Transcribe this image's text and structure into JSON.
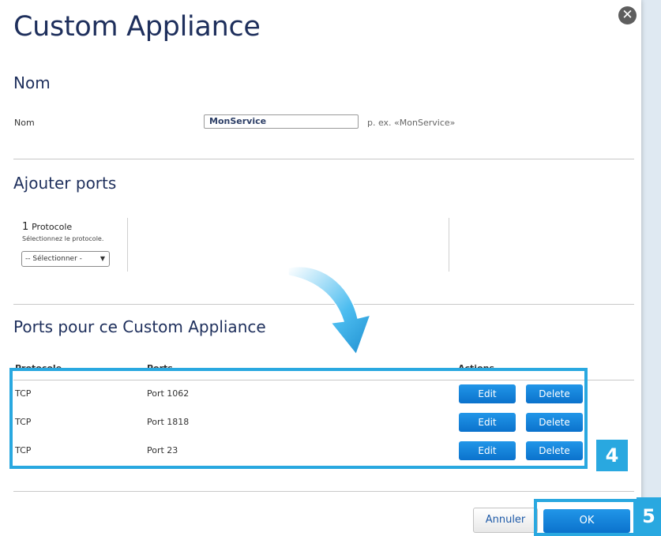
{
  "dialog": {
    "title": "Custom Appliance",
    "close_icon": "close-circle-icon"
  },
  "nom_section": {
    "heading": "Nom",
    "field_label": "Nom",
    "field_value": "MonService",
    "hint": "p. ex. «MonService»"
  },
  "ports_section": {
    "heading": "Ajouter ports",
    "step_number": "1",
    "step_title": "Protocole",
    "step_desc": "Sélectionnez le protocole.",
    "select_value": "-- Sélectionner -",
    "select_arrow": "▼"
  },
  "appliance_ports": {
    "heading": "Ports pour ce Custom Appliance",
    "columns": [
      "Protocole",
      "Ports",
      "Actions"
    ],
    "rows": [
      {
        "protocol": "TCP",
        "port": "Port 1062",
        "edit": "Edit",
        "delete": "Delete"
      },
      {
        "protocol": "TCP",
        "port": "Port 1818",
        "edit": "Edit",
        "delete": "Delete"
      },
      {
        "protocol": "TCP",
        "port": "Port 23",
        "edit": "Edit",
        "delete": "Delete"
      }
    ]
  },
  "footer": {
    "cancel_label": "Annuler",
    "ok_label": "OK"
  },
  "annotations": {
    "badge_4": "4",
    "badge_5": "5",
    "arrow_color": "#29a8e0"
  }
}
